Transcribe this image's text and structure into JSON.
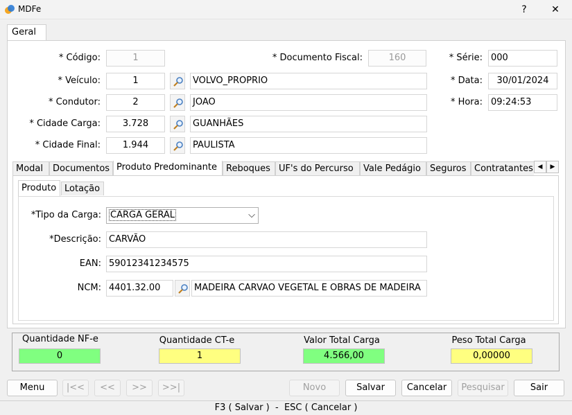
{
  "window": {
    "title": "MDFe",
    "help": "?",
    "close": "✕"
  },
  "main_tab": "Geral",
  "form": {
    "codigo": {
      "label": "* Código:",
      "value": "1"
    },
    "documento_fiscal": {
      "label": "* Documento Fiscal:",
      "value": "160"
    },
    "serie": {
      "label": "* Série:",
      "value": "000"
    },
    "veiculo": {
      "label": "* Veículo:",
      "code": "1",
      "name": "VOLVO_PROPRIO"
    },
    "data": {
      "label": "* Data:",
      "value": "30/01/2024"
    },
    "condutor": {
      "label": "* Condutor:",
      "code": "2",
      "name": "JOAO"
    },
    "hora": {
      "label": "* Hora:",
      "value": "09:24:53"
    },
    "cidade_carga": {
      "label": "* Cidade Carga:",
      "code": "3.728",
      "name": "GUANHÃES"
    },
    "cidade_final": {
      "label": "* Cidade Final:",
      "code": "1.944",
      "name": "PAULISTA"
    }
  },
  "section_tabs": [
    "Modal",
    "Documentos",
    "Produto Predominante",
    "Reboques",
    "UF's do Percurso",
    "Vale Pedágio",
    "Seguros",
    "Contratantes"
  ],
  "inner_tabs": [
    "Produto",
    "Lotação"
  ],
  "produto": {
    "tipo_carga": {
      "label": "*Tipo da Carga:",
      "value": "CARGA GERAL"
    },
    "descricao": {
      "label": "*Descrição:",
      "value": "CARVÃO"
    },
    "ean": {
      "label": "EAN:",
      "value": "59012341234575"
    },
    "ncm": {
      "label": "NCM:",
      "code": "4401.32.00",
      "desc": "MADEIRA CARVAO VEGETAL E OBRAS DE MADEIRA"
    }
  },
  "totals": [
    {
      "label": "Quantidade NF-e",
      "value": "0",
      "color": "#80ff80"
    },
    {
      "label": "Quantidade CT-e",
      "value": "1",
      "color": "#ffff80"
    },
    {
      "label": "Valor Total Carga",
      "value": "4.566,00",
      "color": "#80ff80"
    },
    {
      "label": "Peso Total Carga",
      "value": "0,00000",
      "color": "#ffff80"
    }
  ],
  "buttons": {
    "menu": "Menu",
    "first": "|<<",
    "prev": "<<",
    "next": ">>",
    "last": ">>|",
    "novo": "Novo",
    "salvar": "Salvar",
    "cancelar": "Cancelar",
    "pesquisar": "Pesquisar",
    "sair": "Sair"
  },
  "status": "F3 ( Salvar )  -  ESC ( Cancelar )"
}
